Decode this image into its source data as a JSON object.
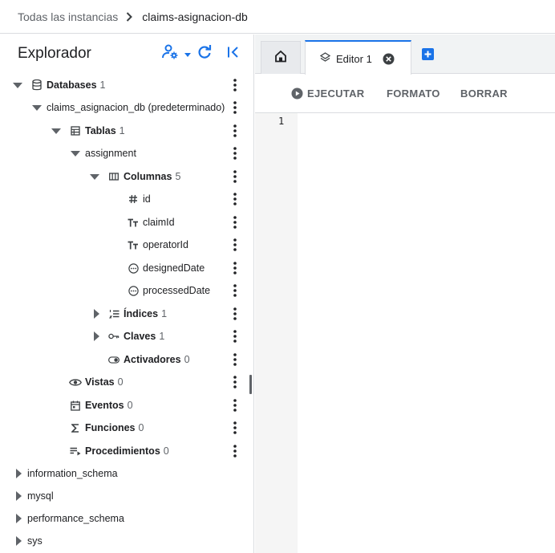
{
  "breadcrumb": {
    "parent": "Todas las instancias",
    "current": "claims-asignacion-db"
  },
  "explorer": {
    "title": "Explorador",
    "actions": [
      "person-settings-icon",
      "refresh-icon",
      "collapse-panel-icon"
    ]
  },
  "tree": {
    "databases": {
      "label": "Databases",
      "count": "1"
    },
    "db": {
      "label": "claims_asignacion_db (predeterminado)"
    },
    "tables": {
      "label": "Tablas",
      "count": "1"
    },
    "table": {
      "label": "assignment"
    },
    "columns": {
      "label": "Columnas",
      "count": "5"
    },
    "column_items": [
      {
        "label": "id",
        "type_icon": "hash-icon"
      },
      {
        "label": "claimId",
        "type_icon": "text-type-icon"
      },
      {
        "label": "operatorId",
        "type_icon": "text-type-icon"
      },
      {
        "label": "designedDate",
        "type_icon": "datetime-icon"
      },
      {
        "label": "processedDate",
        "type_icon": "datetime-icon"
      }
    ],
    "indices": {
      "label": "Índices",
      "count": "1"
    },
    "keys": {
      "label": "Claves",
      "count": "1"
    },
    "triggers": {
      "label": "Activadores",
      "count": "0"
    },
    "views": {
      "label": "Vistas",
      "count": "0"
    },
    "events": {
      "label": "Eventos",
      "count": "0"
    },
    "functions": {
      "label": "Funciones",
      "count": "0"
    },
    "procedures": {
      "label": "Procedimientos",
      "count": "0"
    },
    "other_dbs": [
      "information_schema",
      "mysql",
      "performance_schema",
      "sys"
    ]
  },
  "tabs": {
    "home_icon": "home-icon",
    "editor": {
      "label": "Editor 1"
    }
  },
  "toolbar": {
    "run_label": "EJECUTAR",
    "format_label": "FORMATO",
    "clear_label": "BORRAR"
  },
  "editor": {
    "line_numbers": [
      "1"
    ],
    "content": ""
  },
  "colors": {
    "accent": "#1a73e8",
    "text": "#202124",
    "muted": "#5f6368",
    "border": "#dadce0",
    "tabbar_bg": "#f1f3f4",
    "gutter_bg": "#f5f5f5"
  }
}
